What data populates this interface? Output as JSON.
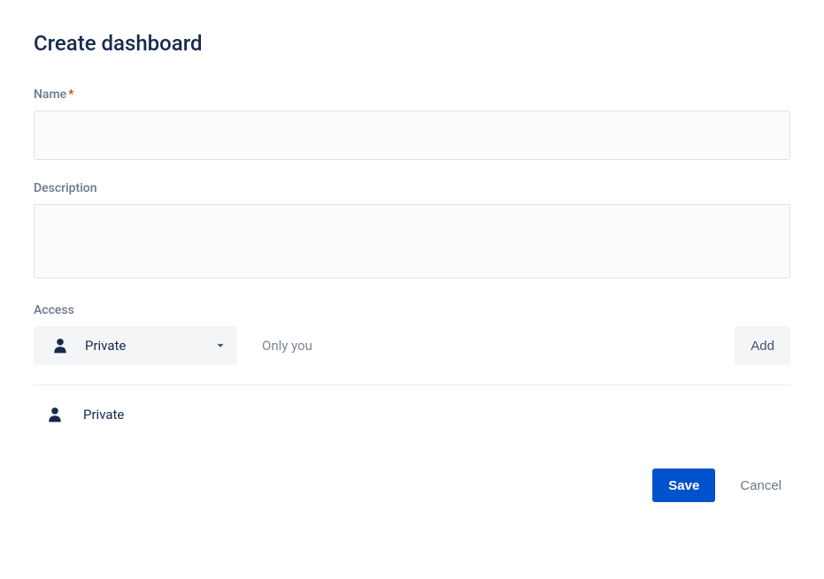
{
  "title": "Create dashboard",
  "fields": {
    "name": {
      "label": "Name",
      "required_mark": "*",
      "value": ""
    },
    "description": {
      "label": "Description",
      "value": ""
    }
  },
  "access": {
    "label": "Access",
    "selected": "Private",
    "hint": "Only you",
    "add_label": "Add",
    "list": [
      {
        "label": "Private"
      }
    ]
  },
  "buttons": {
    "save": "Save",
    "cancel": "Cancel"
  }
}
